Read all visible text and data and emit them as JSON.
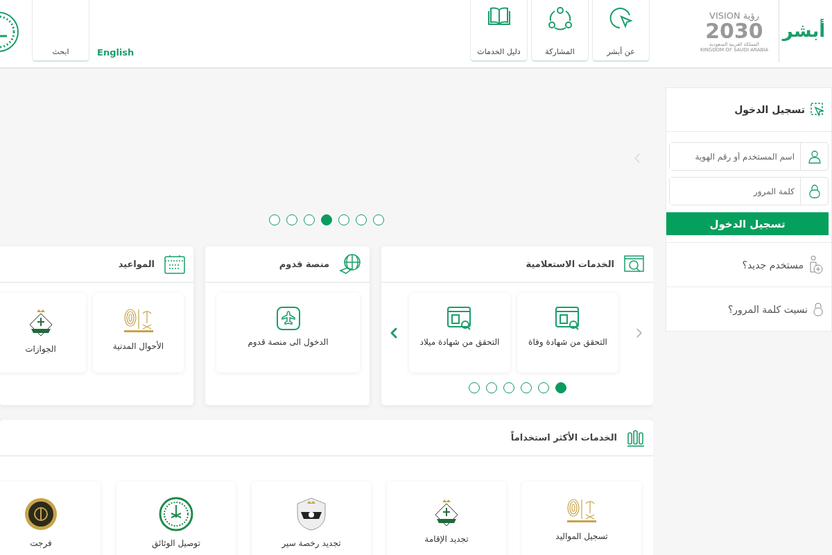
{
  "header": {
    "logo": "أبشر",
    "vision": {
      "word": "VISION",
      "arabic": "رؤية",
      "year": "2030",
      "country_ar": "المملكة العربية السعودية",
      "country_en": "KINGDOM OF SAUDI ARABIA"
    },
    "nav": [
      {
        "label": "عن أبشر"
      },
      {
        "label": "المشاركة"
      },
      {
        "label": "دليل الخدمات"
      }
    ],
    "language": "English",
    "search": "ابحث"
  },
  "hero": {
    "dots": [
      {
        "selected": false
      },
      {
        "selected": false
      },
      {
        "selected": false
      },
      {
        "selected": true
      },
      {
        "selected": false
      },
      {
        "selected": false
      },
      {
        "selected": false
      }
    ]
  },
  "panels": [
    {
      "title": "الخدمات الاستعلامية",
      "items": [
        {
          "label": "التحقق من شهادة وفاة"
        },
        {
          "label": "التحقق من شهادة ميلاد"
        }
      ],
      "dots": [
        {
          "selected": true
        },
        {
          "selected": false
        },
        {
          "selected": false
        },
        {
          "selected": false
        },
        {
          "selected": false
        },
        {
          "selected": false
        }
      ]
    },
    {
      "title": "منصة قدوم",
      "items": [
        {
          "label": "الدخول الى منصة قدوم"
        }
      ]
    },
    {
      "title": "المواعيد",
      "items": [
        {
          "label": "الأحوال المدنية"
        },
        {
          "label": "الجوازات"
        }
      ]
    }
  ],
  "most_used": {
    "title": "الخدمات الأكثر استخداماً",
    "items": [
      {
        "label": "تسجيل المواليد"
      },
      {
        "label": "تجديد الإقامة"
      },
      {
        "label": "تجديد رخصة سير"
      },
      {
        "label": "توصيل الوثائق"
      },
      {
        "label": "فرجت"
      }
    ]
  },
  "login": {
    "title": "تسجيل الدخول",
    "username": {
      "placeholder": "اسم المستخدم أو رقم الهوية"
    },
    "password": {
      "placeholder": "كلمة المرور"
    },
    "button": "تسجيل الدخول",
    "links": [
      "مستخدم جديد؟",
      "نسيت كلمة المرور؟"
    ]
  }
}
